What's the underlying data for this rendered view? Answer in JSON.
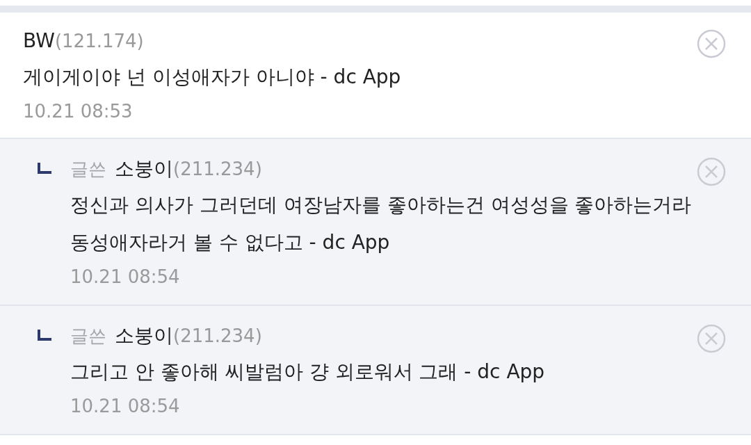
{
  "comments": [
    {
      "kind": "comment",
      "author": "BW",
      "ip": "(121.174)",
      "text": "게이게이야 넌 이성애자가 아니야 - dc App",
      "time": "10.21 08:53"
    },
    {
      "kind": "reply",
      "badge": "글쓴",
      "author": "소붕이",
      "ip": "(211.234)",
      "text": "정신과 의사가 그러던데 여장남자를 좋아하는건 여성성을 좋아하는거라 동성애자라거 볼 수 없다고 - dc App",
      "time": "10.21 08:54"
    },
    {
      "kind": "reply",
      "badge": "글쓴",
      "author": "소붕이",
      "ip": "(211.234)",
      "text": "그리고 안 좋아해 씨발럼아 걍 외로워서 그래 - dc App",
      "time": "10.21 08:54"
    }
  ]
}
